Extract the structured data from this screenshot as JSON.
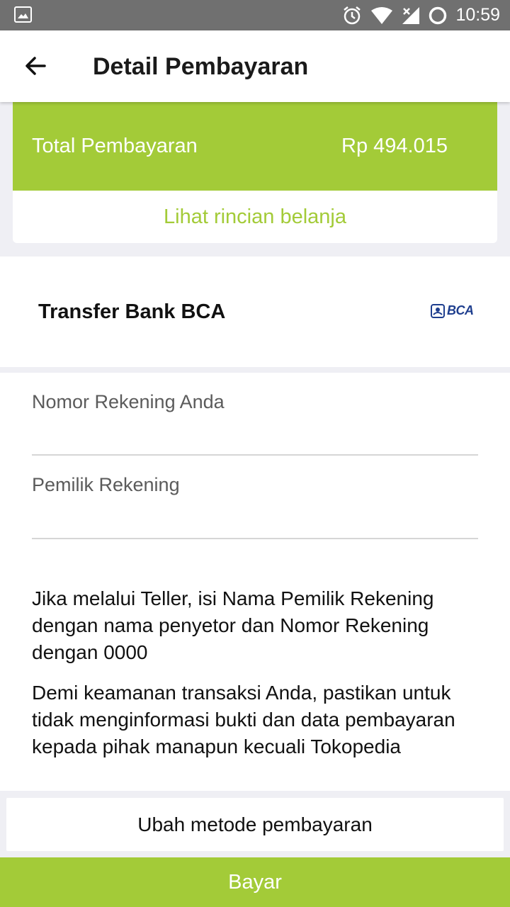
{
  "status_bar": {
    "time": "10:59",
    "icons": [
      "gallery-icon",
      "alarm-icon",
      "wifi-icon",
      "signal-icon",
      "sync-icon"
    ]
  },
  "header": {
    "back_icon": "back-arrow-icon",
    "title": "Detail Pembayaran"
  },
  "summary": {
    "total_label": "Total Pembayaran",
    "total_amount": "Rp 494.015",
    "detail_link": "Lihat rincian belanja"
  },
  "payment_method": {
    "name": "Transfer Bank BCA",
    "logo_text": "BCA"
  },
  "form": {
    "account_number_label": "Nomor Rekening Anda",
    "account_number_value": "",
    "account_owner_label": "Pemilik Rekening",
    "account_owner_value": ""
  },
  "notes": {
    "teller": "Jika melalui Teller, isi Nama Pemilik Rekening dengan nama penyetor dan Nomor Rekening dengan 0000",
    "security": "Demi keamanan transaksi Anda, pastikan untuk tidak menginformasi bukti dan data pembayaran kepada pihak manapun kecuali Tokopedia"
  },
  "actions": {
    "change_method": "Ubah metode pembayaran",
    "pay": "Bayar"
  },
  "colors": {
    "accent": "#a3cb38",
    "status_bar": "#707070",
    "bca_blue": "#1e3e8e"
  }
}
